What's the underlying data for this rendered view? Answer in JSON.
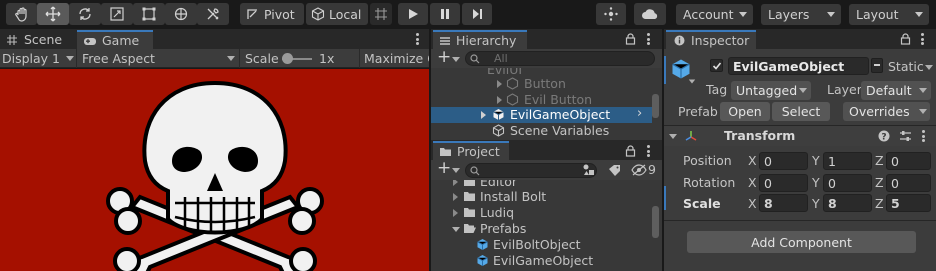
{
  "toolbar": {
    "pivot_label": "Pivot",
    "local_label": "Local",
    "account_label": "Account",
    "layers_label": "Layers",
    "layout_label": "Layout"
  },
  "scene_tab": "Scene",
  "game_tab": "Game",
  "game_bar": {
    "display": "Display 1",
    "aspect": "Free Aspect",
    "scale_label": "Scale",
    "scale_value": "1x",
    "maximize": "Maximize O"
  },
  "hierarchy": {
    "tab": "Hierarchy",
    "search_placeholder": "All",
    "items": [
      {
        "label": "EvilUI"
      },
      {
        "label": "Button"
      },
      {
        "label": "Evil Button"
      },
      {
        "label": "EvilGameObject"
      },
      {
        "label": "Scene Variables"
      }
    ]
  },
  "project": {
    "tab": "Project",
    "hidden_count": "9",
    "items": [
      {
        "label": "Editor"
      },
      {
        "label": "Install Bolt"
      },
      {
        "label": "Ludiq"
      },
      {
        "label": "Prefabs"
      },
      {
        "label": "EvilBoltObject"
      },
      {
        "label": "EvilGameObject"
      }
    ]
  },
  "inspector": {
    "tab": "Inspector",
    "object_name": "EvilGameObject",
    "static_label": "Static",
    "tag_label": "Tag",
    "tag_value": "Untagged",
    "layer_label": "Layer",
    "layer_value": "Default",
    "prefab_label": "Prefab",
    "open_label": "Open",
    "select_label": "Select",
    "overrides_label": "Overrides",
    "transform_label": "Transform",
    "position_label": "Position",
    "rotation_label": "Rotation",
    "scale_label": "Scale",
    "axis_x": "X",
    "axis_y": "Y",
    "axis_z": "Z",
    "position": {
      "x": "0",
      "y": "1",
      "z": "0"
    },
    "rotation": {
      "x": "0",
      "y": "0",
      "z": "0"
    },
    "scale": {
      "x": "8",
      "y": "8",
      "z": "5"
    },
    "add_component_label": "Add Component"
  },
  "colors": {
    "game_bg": "#a51000",
    "accent": "#3a79bb",
    "selection": "#2c5d87"
  }
}
